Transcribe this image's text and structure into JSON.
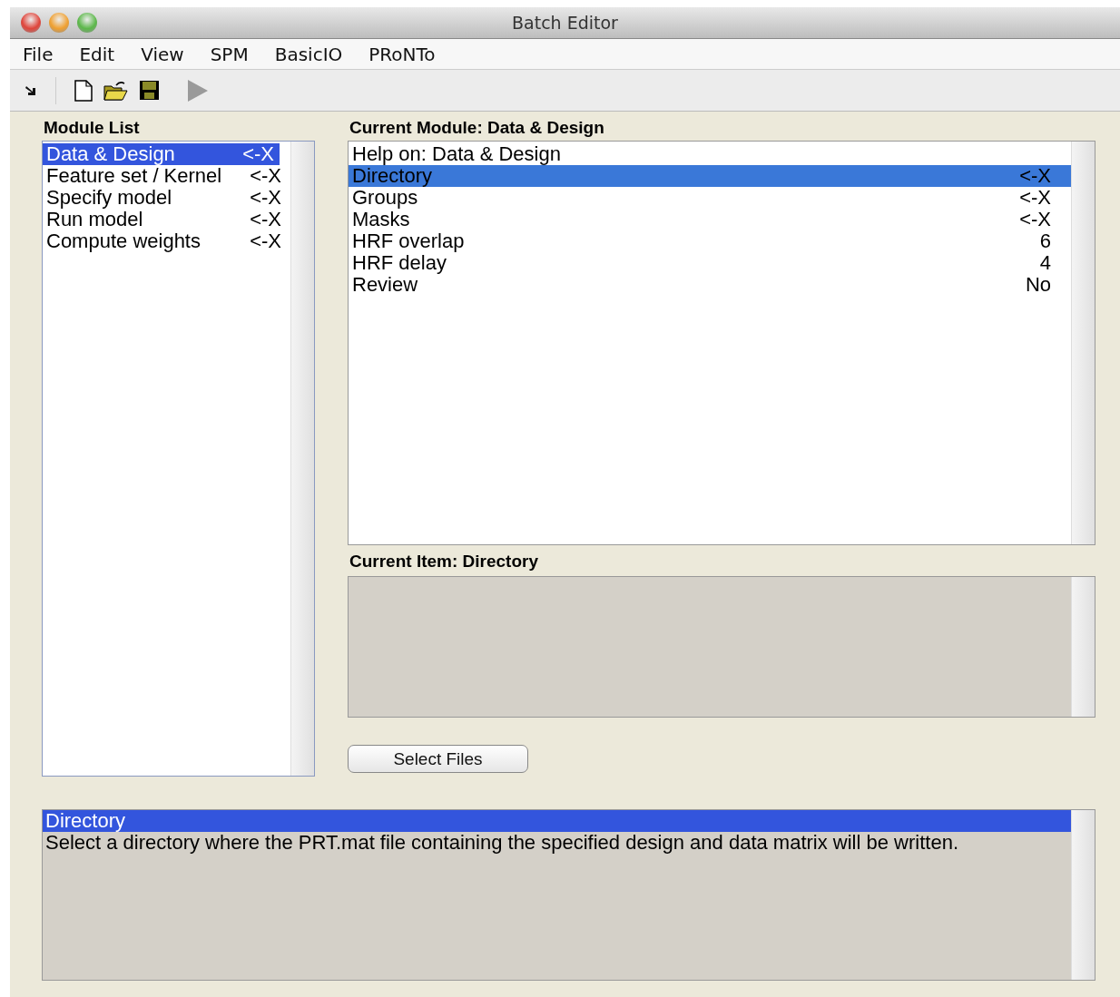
{
  "window": {
    "title": "Batch Editor"
  },
  "menu": [
    "File",
    "Edit",
    "View",
    "SPM",
    "BasicIO",
    "PRoNTo"
  ],
  "module_list": {
    "title": "Module List",
    "items": [
      {
        "label": "Data & Design",
        "value": "<-X",
        "selected": true
      },
      {
        "label": "Feature set / Kernel",
        "value": "<-X",
        "selected": false
      },
      {
        "label": "Specify model",
        "value": "<-X",
        "selected": false
      },
      {
        "label": "Run model",
        "value": "<-X",
        "selected": false
      },
      {
        "label": "Compute weights",
        "value": "<-X",
        "selected": false
      }
    ]
  },
  "current_module": {
    "title": "Current Module: Data & Design",
    "items": [
      {
        "label": "Help on: Data & Design",
        "selected": false
      },
      {
        "label": "Directory",
        "value": "<-X",
        "selected": true
      },
      {
        "label": "Groups",
        "value": "<-X",
        "selected": false
      },
      {
        "label": "Masks",
        "value": "<-X",
        "selected": false
      },
      {
        "label": "HRF overlap",
        "value": "6",
        "selected": false
      },
      {
        "label": "HRF delay",
        "value": "4",
        "selected": false
      },
      {
        "label": "Review",
        "value": "No",
        "selected": false
      }
    ]
  },
  "current_item": {
    "title": "Current Item: Directory"
  },
  "button": "Select Files",
  "help": {
    "title": "Directory",
    "text": "Select a directory where the PRT.mat file containing the specified design and data matrix will be written."
  }
}
